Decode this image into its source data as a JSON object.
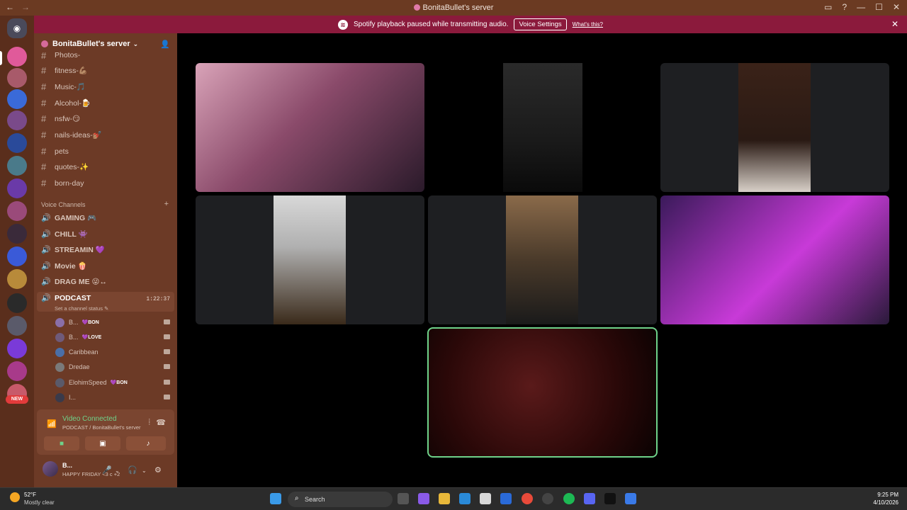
{
  "window": {
    "title": "BonitaBullet's server"
  },
  "notice": {
    "message": "Spotify playback paused while transmitting audio.",
    "voice_settings_label": "Voice Settings",
    "whats_this_label": "What's this?"
  },
  "server": {
    "name": "BonitaBullet's server"
  },
  "text_channels": [
    {
      "name": "Photos-"
    },
    {
      "name": "fitness-💪🏽"
    },
    {
      "name": "Music-🎵"
    },
    {
      "name": "Alcohol-🍺"
    },
    {
      "name": "nsfw-😏"
    },
    {
      "name": "nails-ideas-💅🏽"
    },
    {
      "name": "pets"
    },
    {
      "name": "quotes-✨"
    },
    {
      "name": "born-day"
    }
  ],
  "voice_category": "Voice Channels",
  "voice_channels": [
    {
      "name": "GAMING 🎮"
    },
    {
      "name": "CHILL 👾"
    },
    {
      "name": "STREAMIN 💜"
    },
    {
      "name": "Movie 🍿"
    },
    {
      "name": "DRAG ME 😜↔"
    }
  ],
  "active_voice": {
    "name": "PODCAST",
    "time": "1:22:37",
    "status": "Set a channel status"
  },
  "members": [
    {
      "name": "B...",
      "tag": "💜BON",
      "color": "#8a6fa8"
    },
    {
      "name": "B...",
      "tag": "💜LOVE",
      "color": "#6f5a7a"
    },
    {
      "name": "Caribbean",
      "tag": "",
      "color": "#4a6fa8"
    },
    {
      "name": "Dredae",
      "tag": "",
      "color": "#7a7a7a"
    },
    {
      "name": "ElohimSpeed",
      "tag": "💜BON",
      "color": "#5a5a6a"
    },
    {
      "name": "I...",
      "tag": "",
      "color": "#3a3a4a"
    }
  ],
  "voice_panel": {
    "title": "Video Connected",
    "subtitle": "PODCAST / BonitaBullet's server"
  },
  "user": {
    "name": "B...",
    "status": "HAPPY FRIDAY <3 c +2"
  },
  "rail": {
    "new_label": "NEW"
  },
  "taskbar": {
    "weather_temp": "52°F",
    "weather_desc": "Mostly clear",
    "search_label": "Search",
    "time": "9:25 PM",
    "date": "4/10/2026"
  },
  "colors": {
    "titlebar": "#6b3a22",
    "sidebar": "#6c3a26",
    "notice": "#8b1a3c",
    "connected": "#6fd38a"
  }
}
